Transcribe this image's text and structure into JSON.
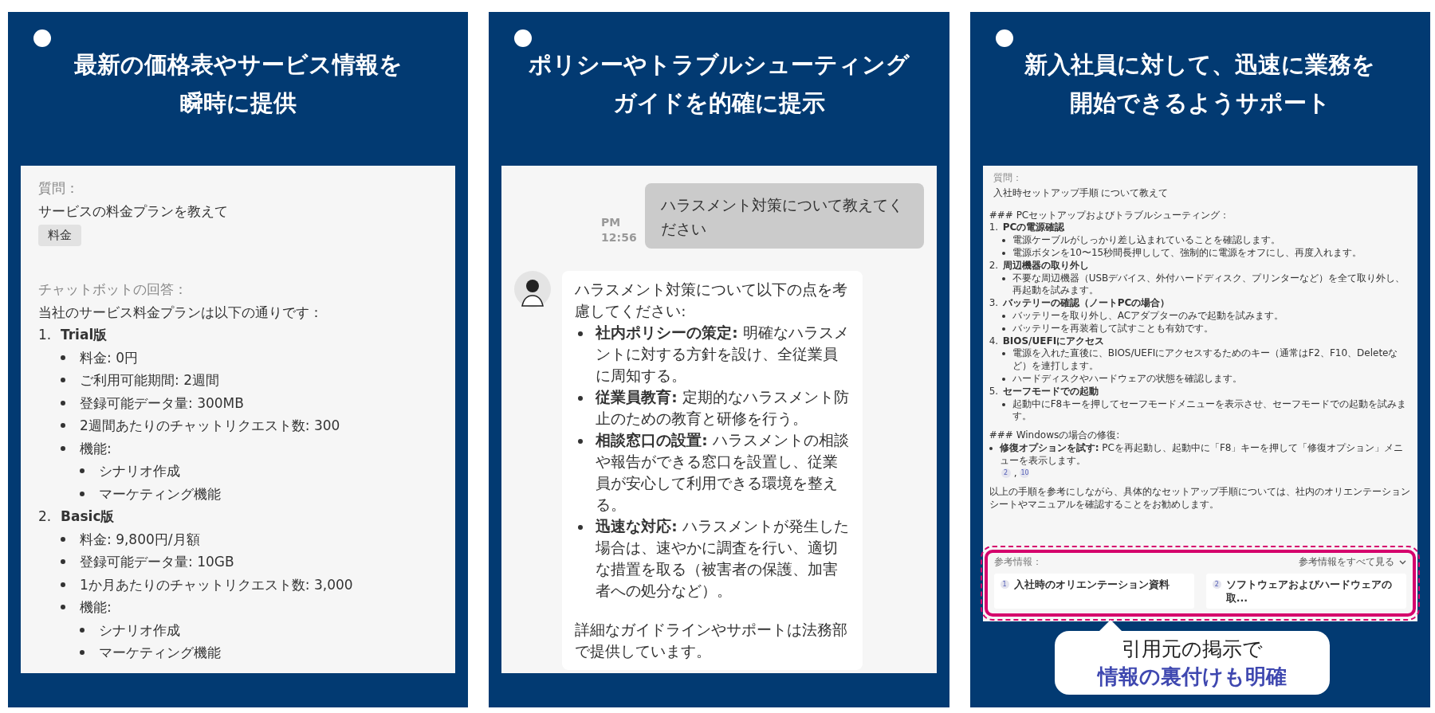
{
  "panels": [
    {
      "kind": "qa",
      "title_lines": [
        "最新の価格表やサービス情報を",
        "瞬時に提供"
      ],
      "question_label": "質問：",
      "question": "サービスの料金プランを教えて",
      "tag": "料金",
      "answer_label": "チャットボットの回答：",
      "answer_intro": "当社のサービス料金プランは以下の通りです：",
      "plans": [
        {
          "number": "1.",
          "name": "Trial版",
          "items": [
            {
              "text": "料金: 0円"
            },
            {
              "text": "ご利用可能期間: 2週間"
            },
            {
              "text": "登録可能データ量: 300MB"
            },
            {
              "text": "2週間あたりのチャットリクエスト数: 300"
            },
            {
              "text": "機能:",
              "children": [
                {
                  "text": "シナリオ作成"
                },
                {
                  "text": "マーケティング機能"
                }
              ]
            }
          ]
        },
        {
          "number": "2.",
          "name": "Basic版",
          "items": [
            {
              "text": "料金: 9,800円/月額"
            },
            {
              "text": "登録可能データ量: 10GB"
            },
            {
              "text": "1か月あたりのチャットリクエスト数: 3,000"
            },
            {
              "text": "機能:",
              "children": [
                {
                  "text": "シナリオ作成"
                },
                {
                  "text": "マーケティング機能"
                }
              ]
            }
          ]
        }
      ]
    },
    {
      "kind": "chat",
      "title_lines": [
        "ポリシーやトラブルシューティング",
        "ガイドを的確に提示"
      ],
      "user_message": {
        "text": "ハラスメント対策について教えてください",
        "time_lines": [
          "PM",
          "12:56"
        ]
      },
      "bot_message": {
        "intro": "ハラスメント対策について以下の点を考慮してください:",
        "bullets": [
          "**社内ポリシーの策定:** 明確なハラスメントに対する方針を設け、全従業員に周知する。",
          "**従業員教育:** 定期的なハラスメント防止のための教育と研修を行う。",
          "**相談窓口の設置:** ハラスメントの相談や報告ができる窓口を設置し、従業員が安心して利用できる環境を整える。",
          "**迅速な対応:** ハラスメントが発生した場合は、速やかに調査を行い、適切な措置を取る（被害者の保護、加害者への処分など）。"
        ],
        "closing": "詳細なガイドラインやサポートは法務部で提供しています。"
      }
    },
    {
      "kind": "guide",
      "title_lines": [
        "新入社員に対して、迅速に業務を",
        "開始できるようサポート"
      ],
      "question_label": "質問：",
      "question": "入社時セットアップ手順 について教えて",
      "heading": "### PCセットアップおよびトラブルシューティング：",
      "steps": [
        {
          "number": "1.",
          "title": "PCの電源確認",
          "items": [
            "電源ケーブルがしっかり差し込まれていることを確認します。",
            "電源ボタンを10〜15秒間長押しして、強制的に電源をオフにし、再度入れます。"
          ]
        },
        {
          "number": "2.",
          "title": "周辺機器の取り外し",
          "items": [
            "不要な周辺機器（USBデバイス、外付ハードディスク、プリンターなど）を全て取り外し、再起動を試みます。"
          ]
        },
        {
          "number": "3.",
          "title": "バッテリーの確認（ノートPCの場合）",
          "items": [
            "バッテリーを取り外し、ACアダプターのみで起動を試みます。",
            "バッテリーを再装着して試すことも有効です。"
          ]
        },
        {
          "number": "4.",
          "title": "BIOS/UEFIにアクセス",
          "items": [
            "電源を入れた直後に、BIOS/UEFIにアクセスするためのキー（通常はF2、F10、Deleteなど）を連打します。",
            "ハードディスクやハードウェアの状態を確認します。"
          ]
        },
        {
          "number": "5.",
          "title": "セーフモードでの起動",
          "items": [
            "起動中にF8キーを押してセーフモードメニューを表示させ、セーフモードでの起動を試みます。"
          ]
        }
      ],
      "heading_2": "### Windowsの場合の修復:",
      "fix": {
        "text": "**修復オプションを試す:** PCを再起動し、起動中に「F8」キーを押して「修復オプション」メニューを表示します。",
        "citations": [
          "2",
          "10"
        ],
        "citation_separator": ","
      },
      "closing": "以上の手順を参考にしながら、具体的なセットアップ手順については、社内のオリエンテーションシートやマニュアルを確認することをお勧めします。",
      "references": {
        "label": "参考情報：",
        "show_all": "参考情報をすべて見る",
        "items": [
          {
            "number": "1",
            "title": "入社時のオリエンテーション資料"
          },
          {
            "number": "2",
            "title": "ソフトウェアおよびハードウェアの取..."
          }
        ]
      },
      "callout": {
        "line_1": "引用元の掲示で",
        "line_2": "情報の裏付けも明確"
      }
    }
  ]
}
